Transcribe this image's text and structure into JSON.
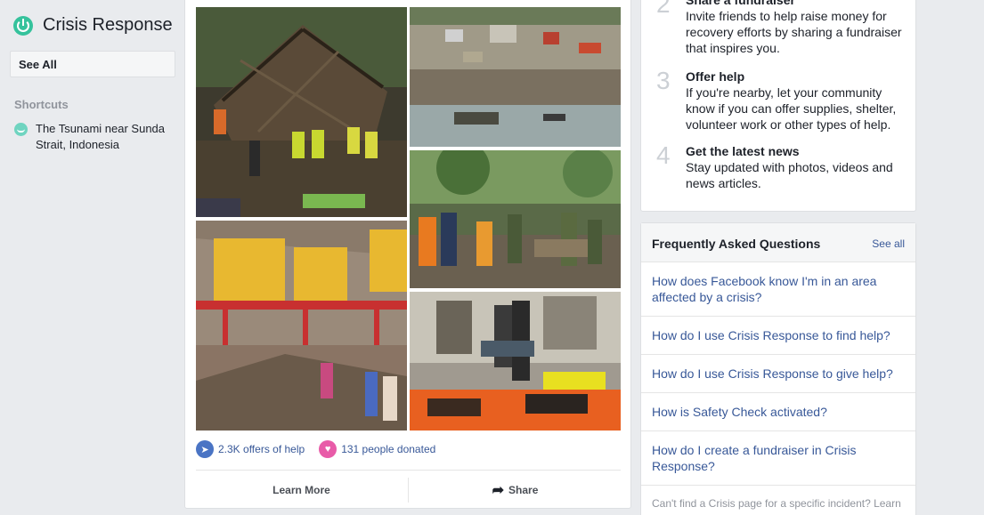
{
  "sidebar": {
    "title": "Crisis Response",
    "see_all": "See All",
    "shortcuts_heading": "Shortcuts",
    "shortcut_item": "The Tsunami near Sunda Strait, Indonesia"
  },
  "main": {
    "stats": {
      "offers": "2.3K offers of help",
      "donated": "131 people donated"
    },
    "learn_more": "Learn More",
    "share": "Share"
  },
  "steps": [
    {
      "num": "2",
      "title": "Share a fundraiser",
      "desc": "Invite friends to help raise money for recovery efforts by sharing a fundraiser that inspires you."
    },
    {
      "num": "3",
      "title": "Offer help",
      "desc": "If you're nearby, let your community know if you can offer supplies, shelter, volunteer work or other types of help."
    },
    {
      "num": "4",
      "title": "Get the latest news",
      "desc": "Stay updated with photos, videos and news articles."
    }
  ],
  "faq": {
    "title": "Frequently Asked Questions",
    "see_all": "See all",
    "items": [
      "How does Facebook know I'm in an area affected by a crisis?",
      "How do I use Crisis Response to find help?",
      "How do I use Crisis Response to give help?",
      "How is Safety Check activated?",
      "How do I create a fundraiser in Crisis Response?"
    ],
    "footer": "Can't find a Crisis page for a specific incident? Learn more"
  },
  "colors": {
    "background": "#e9ebee",
    "link": "#385898",
    "brand_green": "#35c29c"
  }
}
